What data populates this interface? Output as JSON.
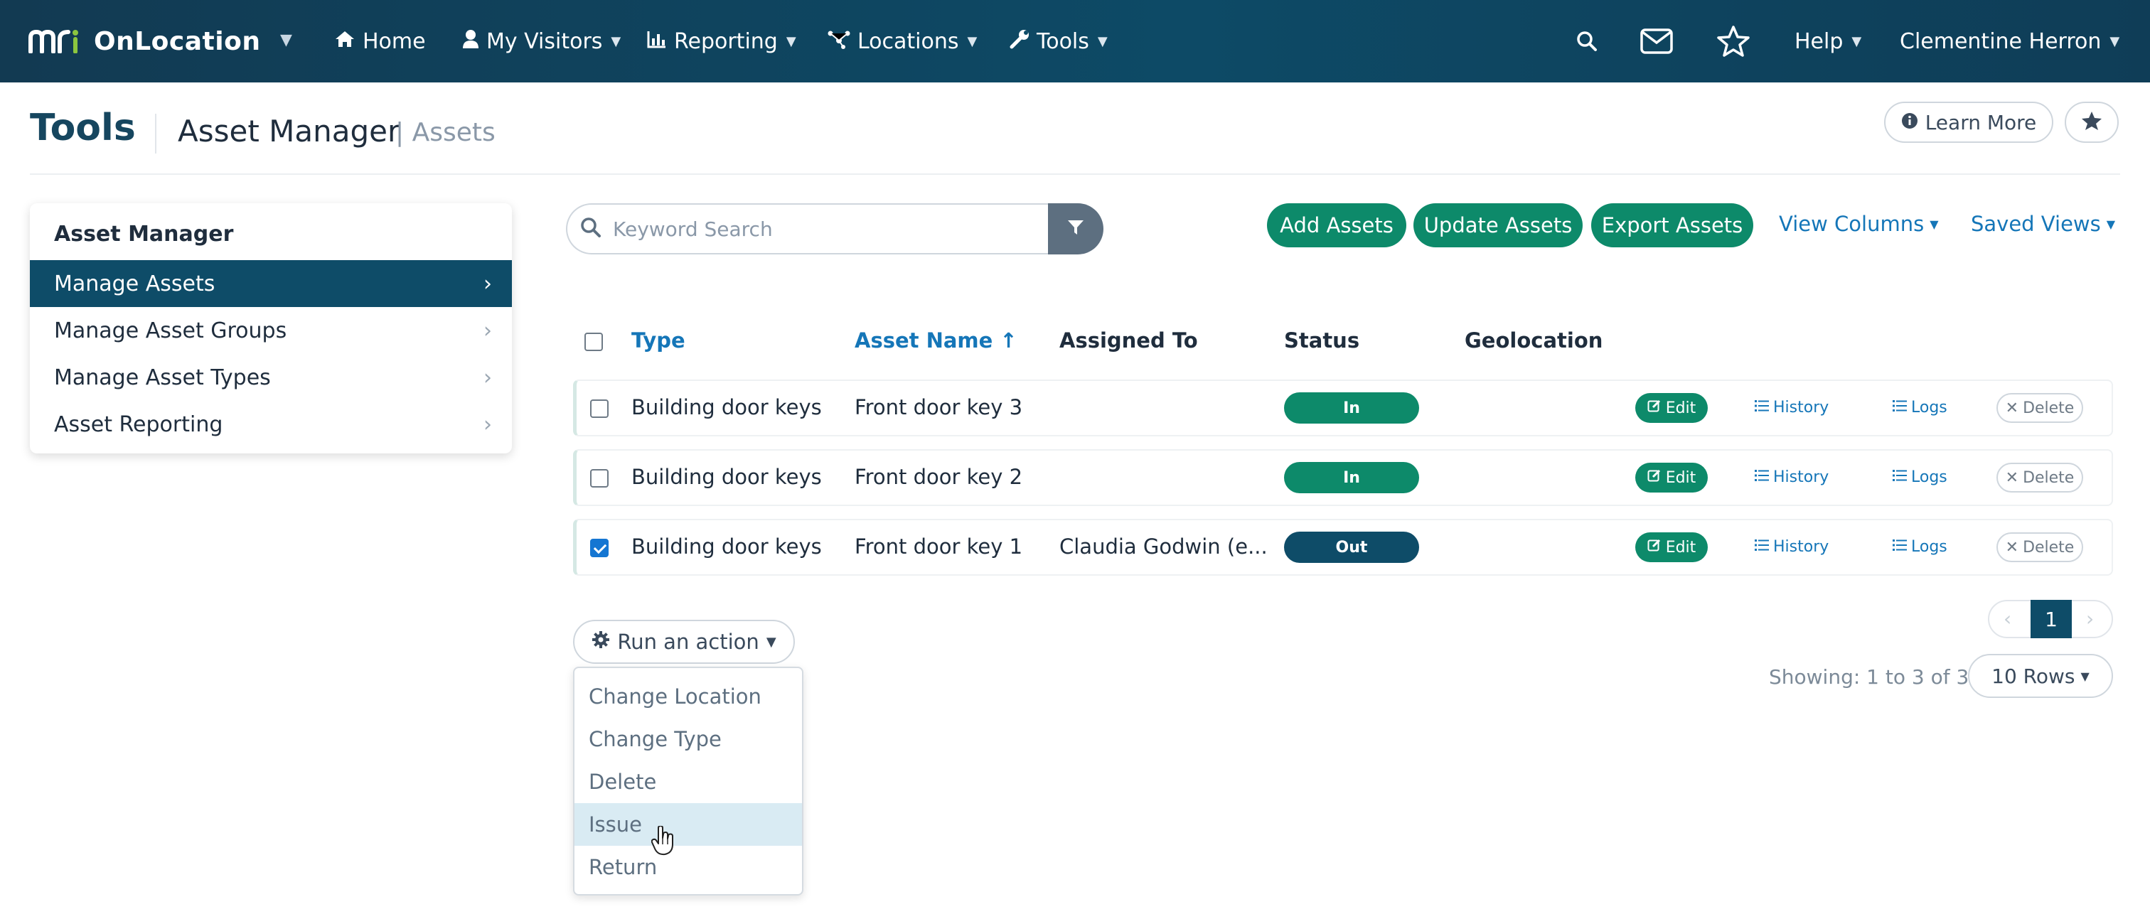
{
  "nav": {
    "brand_mark": "mri",
    "brand_name": "OnLocation",
    "items": [
      {
        "label": "Home",
        "icon": "home-icon"
      },
      {
        "label": "My Visitors",
        "icon": "user-icon"
      },
      {
        "label": "Reporting",
        "icon": "bar-chart-icon"
      },
      {
        "label": "Locations",
        "icon": "network-icon"
      },
      {
        "label": "Tools",
        "icon": "wrench-icon"
      }
    ],
    "help_label": "Help",
    "user_name": "Clementine Herron"
  },
  "header": {
    "title": "Tools",
    "section": "Asset Manager",
    "subsection": "| Assets",
    "learn_more": "Learn More"
  },
  "sidebar": {
    "heading": "Asset Manager",
    "items": [
      {
        "label": "Manage Assets",
        "active": true
      },
      {
        "label": "Manage Asset Groups",
        "active": false
      },
      {
        "label": "Manage Asset Types",
        "active": false
      },
      {
        "label": "Asset Reporting",
        "active": false
      }
    ]
  },
  "toolbar": {
    "search_placeholder": "Keyword Search",
    "add": "Add Assets",
    "update": "Update Assets",
    "export": "Export Assets",
    "view_columns": "View Columns",
    "saved_views": "Saved Views"
  },
  "table": {
    "columns": {
      "type": "Type",
      "asset_name": "Asset Name ↑",
      "assigned_to": "Assigned To",
      "status": "Status",
      "geolocation": "Geolocation"
    },
    "rows": [
      {
        "checked": false,
        "type": "Building door keys",
        "asset_name": "Front door key 3",
        "assigned_to": "",
        "status": "In",
        "geolocation": ""
      },
      {
        "checked": false,
        "type": "Building door keys",
        "asset_name": "Front door key 2",
        "assigned_to": "",
        "status": "In",
        "geolocation": ""
      },
      {
        "checked": true,
        "type": "Building door keys",
        "asset_name": "Front door key 1",
        "assigned_to": "Claudia Godwin (e...",
        "status": "Out",
        "geolocation": ""
      }
    ],
    "row_actions": {
      "edit": "Edit",
      "history": "History",
      "logs": "Logs",
      "delete": "Delete"
    }
  },
  "actions": {
    "run_label": "Run an action",
    "menu": [
      "Change Location",
      "Change Type",
      "Delete",
      "Issue",
      "Return"
    ],
    "hovered": "Issue"
  },
  "pagination": {
    "current_page": "1",
    "showing": "Showing: 1 to 3 of 3",
    "rows_per_page": "10 Rows"
  },
  "colors": {
    "nav_bg": "#0d4a66",
    "primary_green": "#0d8a6a",
    "primary_navy": "#0e4c68",
    "link_blue": "#1576b8"
  }
}
